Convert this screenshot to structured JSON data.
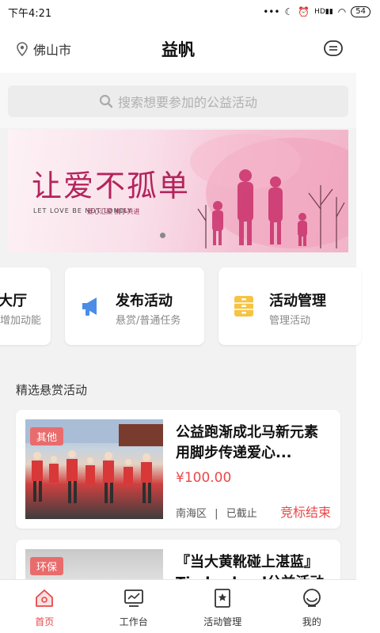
{
  "status_bar": {
    "time": "下午4:21",
    "battery": "54",
    "signal": "HD"
  },
  "header": {
    "location": "佛山市",
    "title": "益帆"
  },
  "search": {
    "placeholder": "搜索想要参加的公益活动"
  },
  "banner": {
    "slogan": "让爱不孤单",
    "sub": "LET LOVE BE NOT LONELY",
    "tag": "爱心汇聚  携手共进"
  },
  "menus": [
    {
      "title": "大厅",
      "sub": "增加动能"
    },
    {
      "title": "发布活动",
      "sub": "悬赏/普通任务"
    },
    {
      "title": "活动管理",
      "sub": "管理活动"
    }
  ],
  "section": {
    "title": "精选悬赏活动"
  },
  "activities": [
    {
      "tag": "其他",
      "title": "公益跑渐成北马新元素 用脚步传递爱心...",
      "price": "¥100.00",
      "district": "南海区",
      "deadline": "已截止",
      "status": "竞标结束"
    },
    {
      "tag": "环保",
      "title": "『当大黄靴碰上湛蓝』Timberland公益活动"
    }
  ],
  "tabs": [
    {
      "label": "首页",
      "icon": "home-icon"
    },
    {
      "label": "工作台",
      "icon": "monitor-icon"
    },
    {
      "label": "活动管理",
      "icon": "bookmark-icon"
    },
    {
      "label": "我的",
      "icon": "profile-icon"
    }
  ],
  "colors": {
    "accent": "#e84848",
    "tag": "#e96c6c",
    "manage_icon": "#f6c343",
    "publish_icon": "#4b8de6"
  }
}
